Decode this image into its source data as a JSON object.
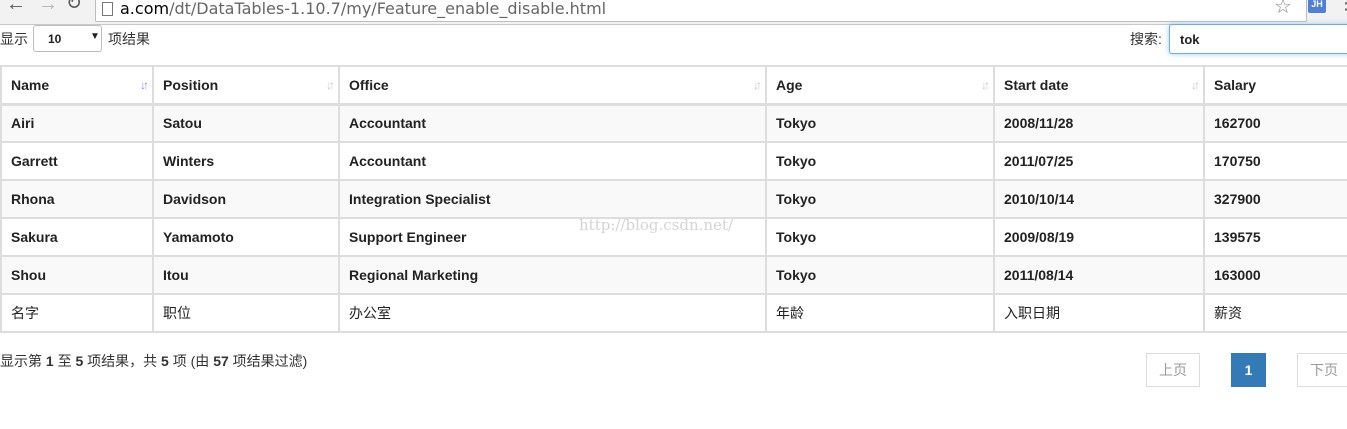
{
  "browser": {
    "url_host": "a.com",
    "url_path": "/dt/DataTables-1.10.7/my/Feature_enable_disable.html",
    "extension_badge": "JH"
  },
  "length": {
    "label": "显示",
    "value": "10",
    "suffix": "项结果"
  },
  "search": {
    "label": "搜索:",
    "value": "tok"
  },
  "table": {
    "columns": [
      "Name",
      "Position",
      "Office",
      "Age",
      "Start date",
      "Salary"
    ],
    "rows": [
      [
        "Airi",
        "Satou",
        "Accountant",
        "Tokyo",
        "2008/11/28",
        "162700"
      ],
      [
        "Garrett",
        "Winters",
        "Accountant",
        "Tokyo",
        "2011/07/25",
        "170750"
      ],
      [
        "Rhona",
        "Davidson",
        "Integration Specialist",
        "Tokyo",
        "2010/10/14",
        "327900"
      ],
      [
        "Sakura",
        "Yamamoto",
        "Support Engineer",
        "Tokyo",
        "2009/08/19",
        "139575"
      ],
      [
        "Shou",
        "Itou",
        "Regional Marketing",
        "Tokyo",
        "2011/08/14",
        "163000"
      ]
    ],
    "footer": [
      "名字",
      "职位",
      "办公室",
      "年龄",
      "入职日期",
      "薪资"
    ],
    "sorted_column": "Name"
  },
  "info": {
    "prefix": "显示第",
    "start": "1",
    "to": "至",
    "end": "5",
    "middle": "项结果，共",
    "total": "5",
    "filter_open": "项 (由",
    "max": "57",
    "filter_close": "项结果过滤)"
  },
  "pagination": {
    "prev": "上页",
    "current": "1",
    "next": "下页"
  },
  "watermark": "http://blog.csdn.net/",
  "colors": {
    "accent": "#337ab7",
    "focus_border": "#66afe9",
    "stripe": "#f9f9f9",
    "border": "#dddddd"
  }
}
